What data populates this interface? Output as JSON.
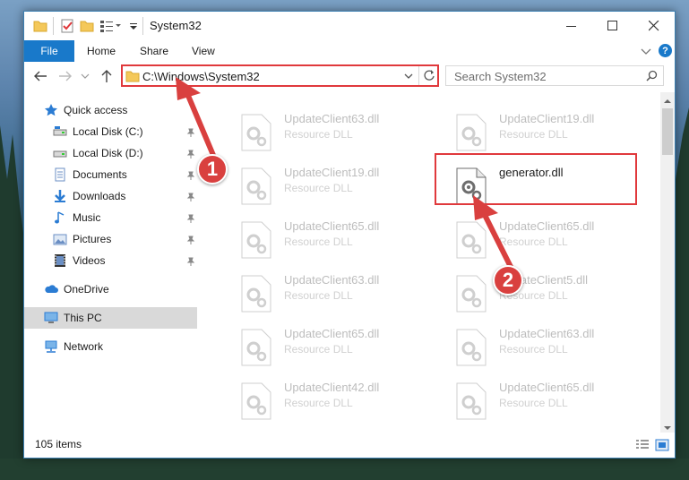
{
  "window": {
    "title": "System32",
    "accent_color": "#1979ca",
    "highlight_color": "#e0393c"
  },
  "ribbon": {
    "tabs": [
      "File",
      "Home",
      "Share",
      "View"
    ]
  },
  "address": {
    "path": "C:\\Windows\\System32",
    "search_placeholder": "Search System32"
  },
  "sidebar": {
    "items": [
      {
        "label": "Quick access",
        "icon": "star-icon",
        "pinned": false
      },
      {
        "label": "Local Disk (C:)",
        "icon": "drive-icon",
        "pinned": true
      },
      {
        "label": "Local Disk (D:)",
        "icon": "drive-icon",
        "pinned": true
      },
      {
        "label": "Documents",
        "icon": "documents-icon",
        "pinned": true
      },
      {
        "label": "Downloads",
        "icon": "download-icon",
        "pinned": true
      },
      {
        "label": "Music",
        "icon": "music-icon",
        "pinned": true
      },
      {
        "label": "Pictures",
        "icon": "pictures-icon",
        "pinned": true
      },
      {
        "label": "Videos",
        "icon": "videos-icon",
        "pinned": true
      },
      {
        "label": "OneDrive",
        "icon": "cloud-icon",
        "pinned": false
      },
      {
        "label": "This PC",
        "icon": "computer-icon",
        "pinned": false,
        "selected": true
      },
      {
        "label": "Network",
        "icon": "network-icon",
        "pinned": false
      }
    ]
  },
  "files": [
    {
      "name": "UpdateClient63.dll",
      "type": "Resource DLL"
    },
    {
      "name": "UpdateClient19.dll",
      "type": "Resource DLL"
    },
    {
      "name": "UpdateClient19.dll",
      "type": "Resource DLL"
    },
    {
      "name": "generator.dll",
      "type": "",
      "highlighted": true
    },
    {
      "name": "UpdateClient65.dll",
      "type": "Resource DLL"
    },
    {
      "name": "UpdateClient65.dll",
      "type": "Resource DLL"
    },
    {
      "name": "UpdateClient63.dll",
      "type": "Resource DLL"
    },
    {
      "name": "UpdateClient5.dll",
      "type": "Resource DLL"
    },
    {
      "name": "UpdateClient65.dll",
      "type": "Resource DLL"
    },
    {
      "name": "UpdateClient63.dll",
      "type": "Resource DLL"
    },
    {
      "name": "UpdateClient42.dll",
      "type": "Resource DLL"
    },
    {
      "name": "UpdateClient65.dll",
      "type": "Resource DLL"
    }
  ],
  "status": {
    "item_count": "105 items"
  },
  "annotations": {
    "step1": "1",
    "step2": "2"
  }
}
